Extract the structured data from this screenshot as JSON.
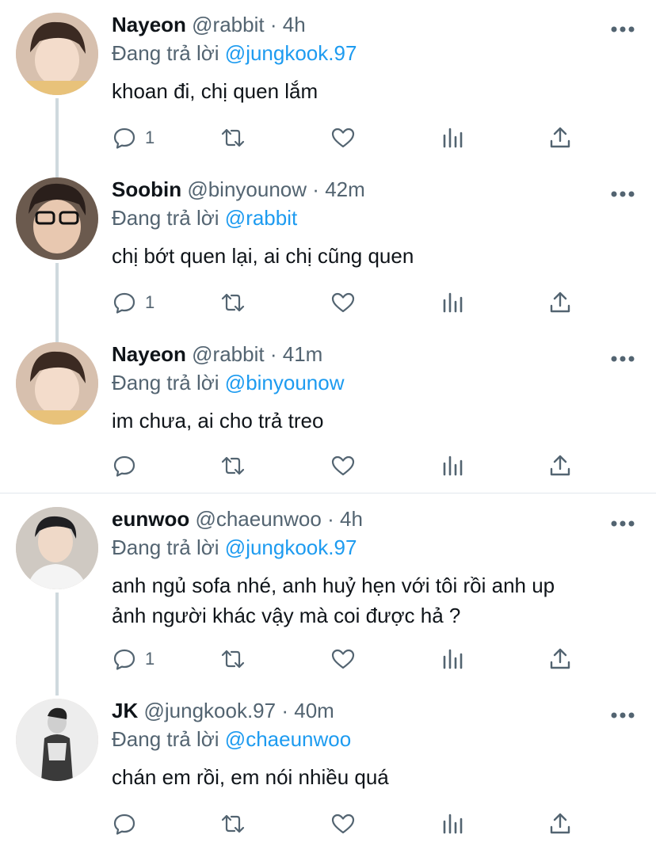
{
  "tweets": [
    {
      "name": "Nayeon",
      "handle": "@rabbit",
      "dot": "·",
      "time": "4h",
      "reply_prefix": "Đang trả lời",
      "reply_to": "@jungkook.97",
      "text_lines": [
        "khoan đi, chị quen lắm"
      ],
      "reply_count": "1"
    },
    {
      "name": "Soobin",
      "handle": "@binyounow",
      "dot": "·",
      "time": "42m",
      "reply_prefix": "Đang trả lời",
      "reply_to": "@rabbit",
      "text_lines": [
        "chị bớt quen lại, ai chị cũng quen"
      ],
      "reply_count": "1"
    },
    {
      "name": "Nayeon",
      "handle": "@rabbit",
      "dot": "·",
      "time": "41m",
      "reply_prefix": "Đang trả lời",
      "reply_to": "@binyounow",
      "text_lines": [
        "im chưa, ai cho trả treo"
      ],
      "reply_count": ""
    },
    {
      "name": "eunwoo",
      "handle": "@chaeunwoo",
      "dot": "·",
      "time": "4h",
      "reply_prefix": "Đang trả lời",
      "reply_to": "@jungkook.97",
      "text_lines": [
        "anh ngủ sofa nhé, anh huỷ hẹn với tôi rồi anh up",
        "ảnh người khác vậy mà coi được hả ?"
      ],
      "reply_count": "1"
    },
    {
      "name": "JK",
      "handle": "@jungkook.97",
      "dot": "·",
      "time": "40m",
      "reply_prefix": "Đang trả lời",
      "reply_to": "@chaeunwoo",
      "text_lines": [
        "chán em rồi, em nói nhiều quá"
      ],
      "reply_count": ""
    }
  ],
  "icons": {
    "reply": "reply-icon",
    "retweet": "retweet-icon",
    "like": "like-icon",
    "views": "views-icon",
    "share": "share-icon",
    "more": "more-icon"
  },
  "colors": {
    "mention": "#1d9bf0",
    "muted": "#536471",
    "text": "#0f1419",
    "thread_line": "#cfd9de"
  }
}
